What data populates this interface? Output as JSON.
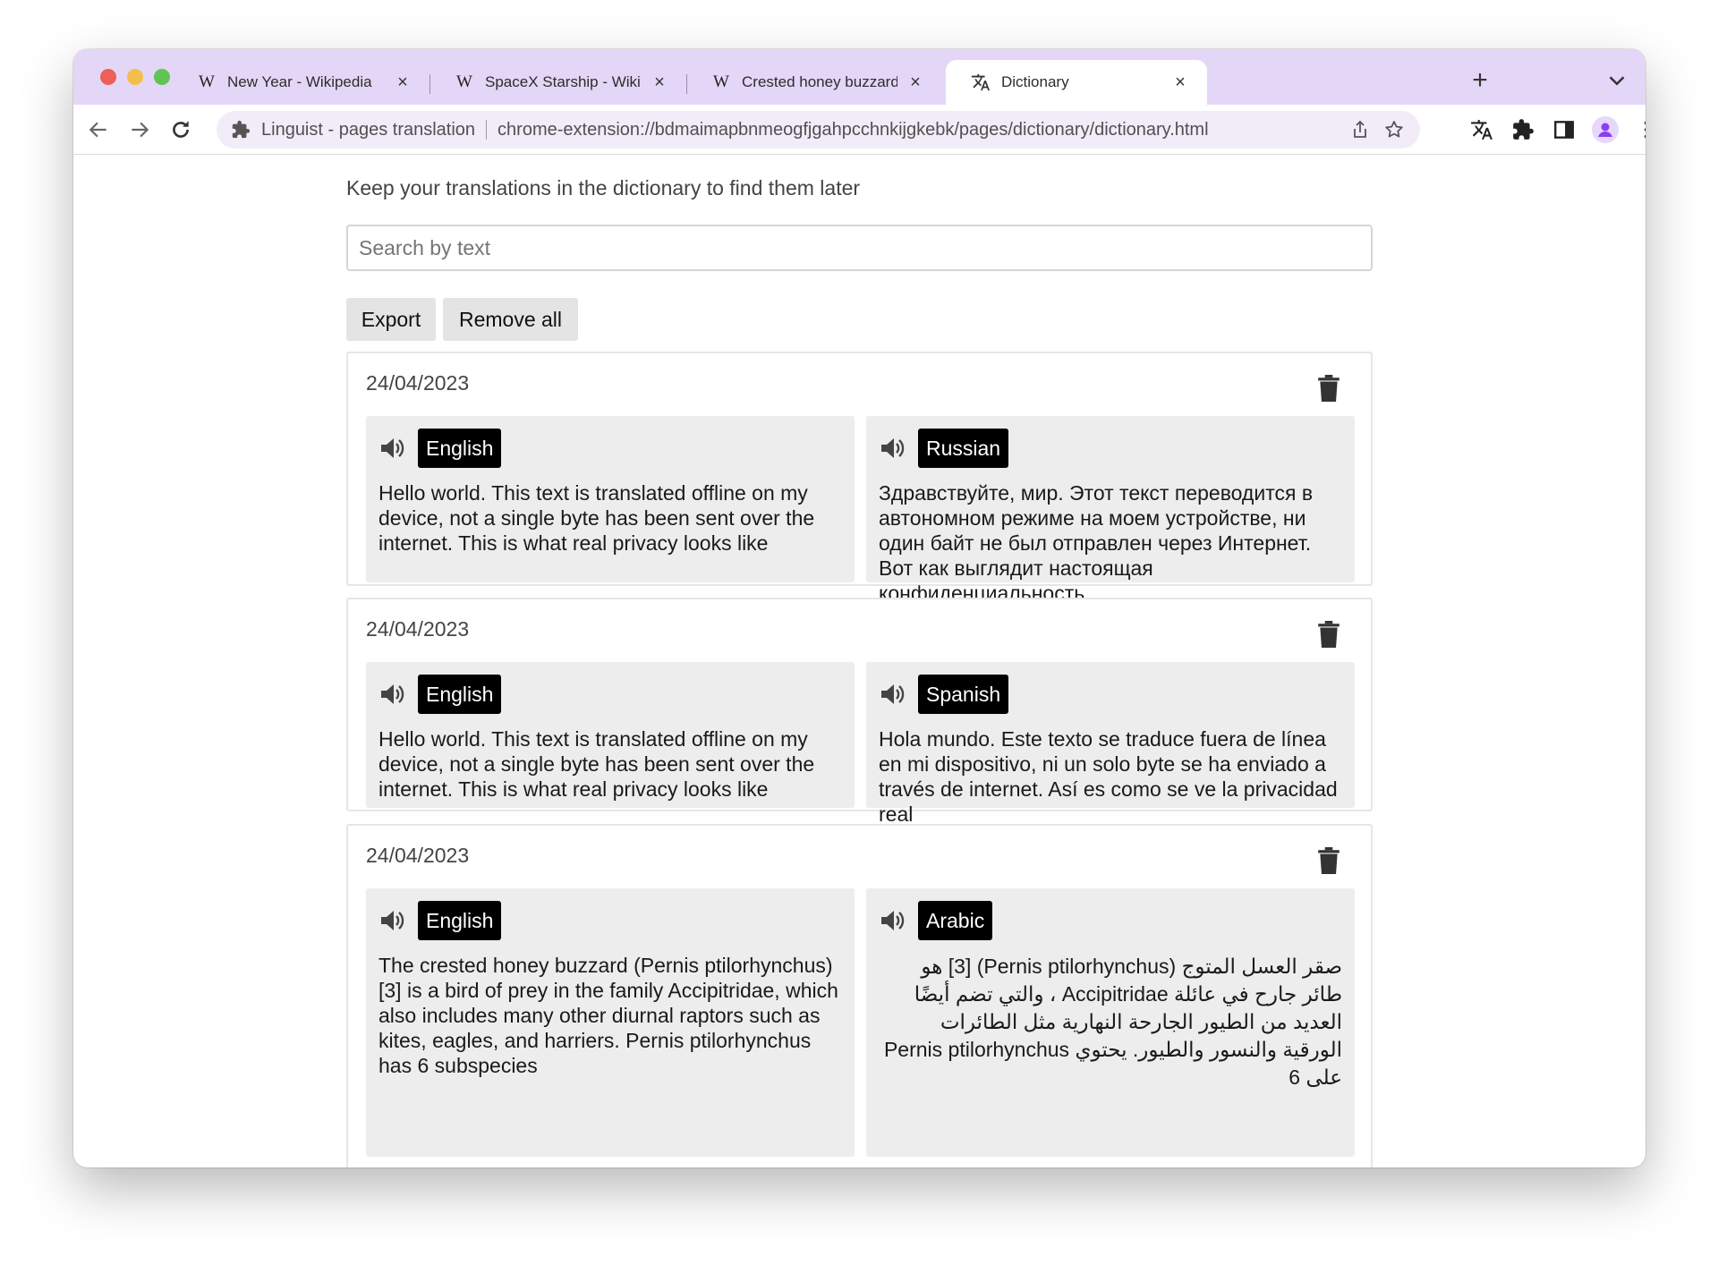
{
  "tabs": [
    {
      "favicon": "W",
      "title": "New Year - Wikipedia",
      "close": "×"
    },
    {
      "favicon": "W",
      "title": "SpaceX Starship - Wikipedia",
      "close": "×"
    },
    {
      "favicon": "W",
      "title": "Crested honey buzzard - Wikip",
      "close": "×"
    },
    {
      "favicon": "translate-icon",
      "title": "Dictionary",
      "close": "×"
    }
  ],
  "new_tab_label": "+",
  "omnibox": {
    "extension_name": "Linguist - pages translation",
    "url": "chrome-extension://bdmaimapbnmeogfjgahpcchnkijgkebk/pages/dictionary/dictionary.html"
  },
  "page": {
    "intro": "Keep your translations in the dictionary to find them later",
    "search_placeholder": "Search by text",
    "export_label": "Export",
    "remove_all_label": "Remove all"
  },
  "entries": [
    {
      "date": "24/04/2023",
      "source": {
        "lang": "English",
        "text": "Hello world. This text is translated offline on my device, not a single byte has been sent over the internet. This is what real privacy looks like"
      },
      "target": {
        "lang": "Russian",
        "text": "Здравствуйте, мир. Этот текст переводится в автономном режиме на моем устройстве, ни один байт не был отправлен через Интернет. Вот как выглядит настоящая конфиденциальность"
      }
    },
    {
      "date": "24/04/2023",
      "source": {
        "lang": "English",
        "text": "Hello world. This text is translated offline on my device, not a single byte has been sent over the internet. This is what real privacy looks like"
      },
      "target": {
        "lang": "Spanish",
        "text": "Hola mundo. Este texto se traduce fuera de línea en mi dispositivo, ni un solo byte se ha enviado a través de internet. Así es como se ve la privacidad real"
      }
    },
    {
      "date": "24/04/2023",
      "source": {
        "lang": "English",
        "text": "The crested honey buzzard (Pernis ptilorhynchus)[3] is a bird of prey in the family Accipitridae, which also includes many other diurnal raptors such as kites, eagles, and harriers. Pernis ptilorhynchus has 6 subspecies"
      },
      "target": {
        "lang": "Arabic",
        "text": "صقر العسل المتوج (Pernis ptilorhynchus) [3] هو طائر جارح في عائلة Accipitridae ، والتي تضم أيضًا العديد من الطيور الجارحة النهارية مثل الطائرات الورقية والنسور والطيور. يحتوي Pernis ptilorhynchus على 6"
      }
    }
  ],
  "colors": {
    "tab_strip": "#e4d6f6",
    "omnibox": "#f1ecf8",
    "pane": "#ededed",
    "lang_badge": "#000000",
    "profile": "#8a3ff0"
  }
}
